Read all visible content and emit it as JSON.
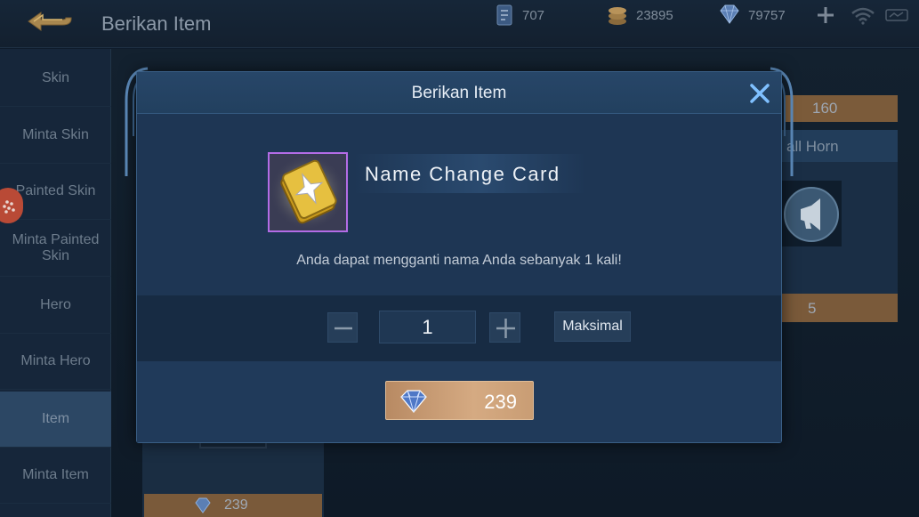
{
  "header": {
    "title": "Berikan Item",
    "resources": {
      "tickets": "707",
      "coins": "23895",
      "diamonds": "79757"
    }
  },
  "sidebar": {
    "items": [
      {
        "label": "Skin"
      },
      {
        "label": "Minta Skin"
      },
      {
        "label": "Painted Skin"
      },
      {
        "label": "Minta Painted Skin"
      },
      {
        "label": "Hero"
      },
      {
        "label": "Minta Hero"
      },
      {
        "label": "Item"
      },
      {
        "label": "Minta Item"
      }
    ],
    "active_index": 6
  },
  "background": {
    "left_card_price": "239",
    "right_card_top_price": "160",
    "right_card_title": "all Horn",
    "right_card_price": "5"
  },
  "modal": {
    "title": "Berikan Item",
    "item_name": "Name Change Card",
    "item_description": "Anda dapat mengganti nama Anda sebanyak 1 kali!",
    "quantity": "1",
    "max_label": "Maksimal",
    "price": "239"
  },
  "colors": {
    "accent_gold": "#d5aa82",
    "item_frame": "#b36ce6",
    "modal_bg": "#203a5a"
  },
  "icons": {
    "back": "back-arrow-icon",
    "close": "close-icon",
    "diamond": "diamond-icon",
    "ticket": "ticket-icon",
    "coin": "coin-icon",
    "item": "name-change-card-icon"
  }
}
